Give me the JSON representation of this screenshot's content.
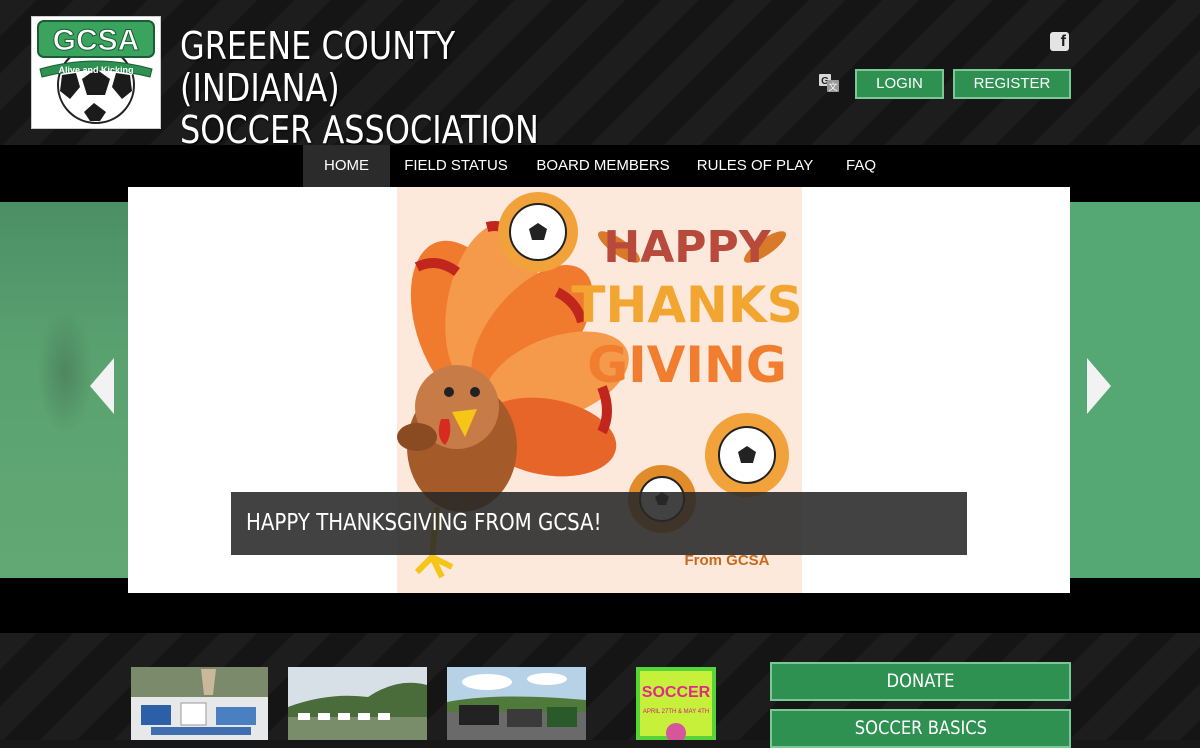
{
  "header": {
    "logo": {
      "text": "GCSA",
      "tagline": "Alive and Kicking"
    },
    "title_line1": "GREENE COUNTY (INDIANA)",
    "title_line2": "SOCCER ASSOCIATION",
    "login_label": "LOGIN",
    "register_label": "REGISTER",
    "icons": [
      "facebook-icon",
      "translate-icon"
    ]
  },
  "nav": {
    "items": [
      {
        "label": "HOME",
        "active": true
      },
      {
        "label": "FIELD STATUS"
      },
      {
        "label": "BOARD MEMBERS"
      },
      {
        "label": "RULES OF PLAY"
      },
      {
        "label": "FAQ"
      }
    ]
  },
  "slider": {
    "image": {
      "headline": [
        "HAPPY",
        "THANKS",
        "GIVING"
      ],
      "signature": "From GCSA"
    },
    "caption": "HAPPY THANKSGIVING FROM GCSA!"
  },
  "flyer": {
    "title": "SOCCER",
    "detail": "APRIL 27TH & MAY 4TH"
  },
  "sidebar": {
    "donate_label": "DONATE",
    "basics_label": "SOCCER BASICS"
  },
  "colors": {
    "accent_green": "#2e9152",
    "accent_border": "#7cc796",
    "nav_bg": "#000000",
    "header_bg": "#1d1d1d"
  }
}
